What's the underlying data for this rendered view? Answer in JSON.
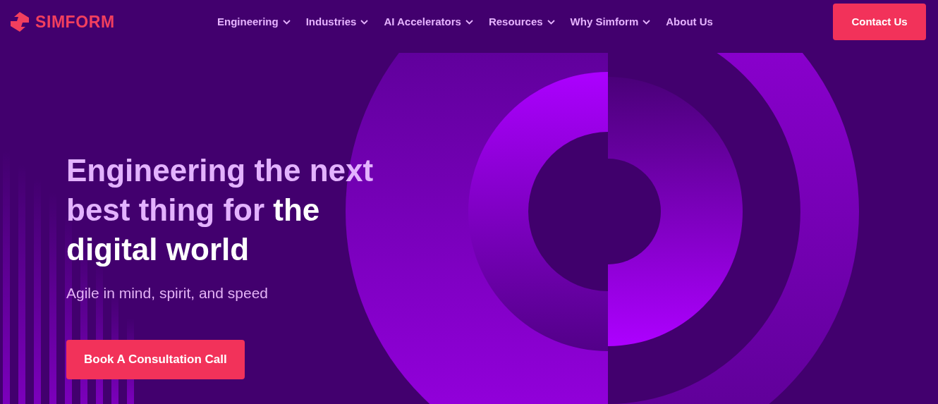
{
  "logo": {
    "text": "SIMFORM"
  },
  "nav": [
    {
      "label": "Engineering",
      "dropdown": true
    },
    {
      "label": "Industries",
      "dropdown": true
    },
    {
      "label": "AI Accelerators",
      "dropdown": true
    },
    {
      "label": "Resources",
      "dropdown": true
    },
    {
      "label": "Why Simform",
      "dropdown": true
    },
    {
      "label": "About Us",
      "dropdown": false
    }
  ],
  "contact_button": "Contact Us",
  "hero": {
    "heading_accent": "Engineering the next best thing for",
    "heading_rest": "the digital world",
    "subtitle": "Agile in mind, spirit, and speed",
    "cta": "Book A Consultation Call"
  }
}
